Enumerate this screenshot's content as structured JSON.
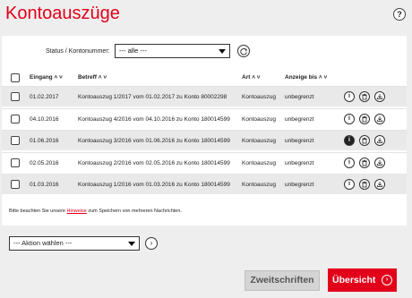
{
  "page": {
    "title": "Kontoauszüge",
    "help_icon": "?"
  },
  "filter": {
    "label": "Status / Kontonummer:",
    "selected": "--- alle ---"
  },
  "table": {
    "headers": {
      "eingang": "Eingang ˄ ˅",
      "betreff": "Betreff ˄ ˅",
      "art": "Art ˄ ˅",
      "anzeige": "Anzeige bis ˄ ˅"
    },
    "rows": [
      {
        "date": "01.02.2017",
        "subject": "Kontoauszug 1/2017 vom 01.02.2017 zu Konto 80002298",
        "type": "Kontoauszug",
        "until": "unbegrenzt"
      },
      {
        "date": "04.10.2016",
        "subject": "Kontoauszug 4/2016 vom 04.10.2016 zu Konto 180014599",
        "type": "Kontoauszug",
        "until": "unbegrenzt"
      },
      {
        "date": "01.06.2016",
        "subject": "Kontoauszug 3/2016 vom 01.06.2016 zu Konto 180014599",
        "type": "Kontoauszug",
        "until": "unbegrenzt"
      },
      {
        "date": "02.05.2016",
        "subject": "Kontoauszug 2/2016 vom 02.05.2016 zu Konto 180014599",
        "type": "Kontoauszug",
        "until": "unbegrenzt"
      },
      {
        "date": "01.03.2016",
        "subject": "Kontoauszug 1/2016 vom 01.03.2016 zu Konto 180014599",
        "type": "Kontoauszug",
        "until": "unbegrenzt"
      }
    ],
    "row_icons": {
      "info": "i",
      "delete": "🗑",
      "download": "⤓"
    }
  },
  "note": {
    "before": "Bitte beachten Sie unsere ",
    "link": "Hinweise",
    "after": " zum Speichern von mehreren Nachrichten."
  },
  "action": {
    "selected": "--- Aktion wählen ---",
    "go_icon": "›"
  },
  "buttons": {
    "secondary": "Zweitschriften",
    "primary": "Übersicht",
    "primary_icon": "›"
  },
  "colors": {
    "accent": "#e2001a"
  }
}
